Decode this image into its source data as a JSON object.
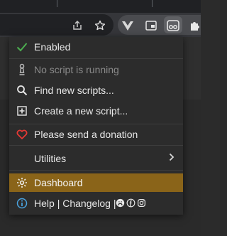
{
  "colors": {
    "menu_bg": "#2c2c2c",
    "highlight": "#8a6419",
    "check_green": "#4caf50",
    "heart_red": "#e53935",
    "info_blue": "#4aa3df",
    "muted_text": "#8a8a8a"
  },
  "menu": {
    "enabled": {
      "label": "Enabled",
      "icon": "check-icon"
    },
    "status": {
      "label": "No script is running",
      "icon": "chess-pawn-icon"
    },
    "find": {
      "label": "Find new scripts...",
      "icon": "search-icon"
    },
    "create": {
      "label": "Create a new script...",
      "icon": "plus-square-icon"
    },
    "donate": {
      "label": "Please send a donation",
      "icon": "heart-icon"
    },
    "utilities": {
      "label": "Utilities",
      "icon": "chevron-right-icon"
    },
    "dashboard": {
      "label": "Dashboard",
      "icon": "gear-icon"
    },
    "help": {
      "help_label": "Help",
      "sep1": "|",
      "changelog_label": "Changelog",
      "sep2": "|",
      "icon": "info-icon",
      "links": [
        "github-icon",
        "facebook-icon",
        "instagram-icon"
      ]
    }
  }
}
